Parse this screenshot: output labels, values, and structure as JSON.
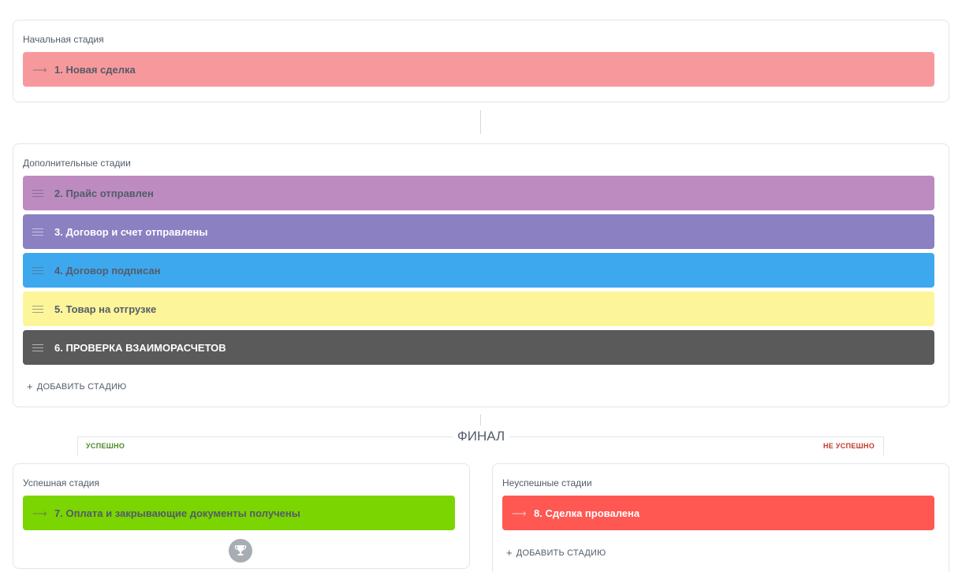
{
  "initial": {
    "title": "Начальная стадия",
    "stage": {
      "label": "1. Новая сделка",
      "color": "#f7999c",
      "text_color": "#535c69",
      "icon": "arrow-right-icon"
    }
  },
  "additional": {
    "title": "Дополнительные стадии",
    "stages": [
      {
        "label": "2. Прайс отправлен",
        "color": "#bd8bc0",
        "text_color": "#535c69",
        "icon": "drag-handle-icon"
      },
      {
        "label": "3. Договор и счет отправлены",
        "color": "#8a80c2",
        "text_color": "#ffffff",
        "icon": "drag-handle-icon"
      },
      {
        "label": "4. Договор подписан",
        "color": "#3ea8ee",
        "text_color": "#535c69",
        "icon": "drag-handle-icon"
      },
      {
        "label": "5. Товар на отгрузке",
        "color": "#fdf599",
        "text_color": "#535c69",
        "icon": "drag-handle-icon"
      },
      {
        "label": "6. ПРОВЕРКА ВЗАИМОРАСЧЕТОВ",
        "color": "#5a5a5a",
        "text_color": "#ffffff",
        "icon": "drag-handle-icon"
      }
    ],
    "add_label": "ДОБАВИТЬ СТАДИЮ"
  },
  "final": {
    "title": "ФИНАЛ",
    "success_tag": "УСПЕШНО",
    "fail_tag": "НЕ УСПЕШНО",
    "success_color": "#4a8a2a",
    "fail_color": "#c0392b"
  },
  "success": {
    "title": "Успешная стадия",
    "stage": {
      "label": "7. Оплата и закрывающие документы получены",
      "color": "#7bd500",
      "text_color": "#535c69",
      "icon": "arrow-right-icon"
    },
    "icon": "trophy-icon"
  },
  "failure": {
    "title": "Неуспешные стадии",
    "stage": {
      "label": "8. Сделка провалена",
      "color": "#ff5752",
      "text_color": "#ffffff",
      "icon": "arrow-right-icon"
    },
    "add_label": "ДОБАВИТЬ СТАДИЮ"
  }
}
